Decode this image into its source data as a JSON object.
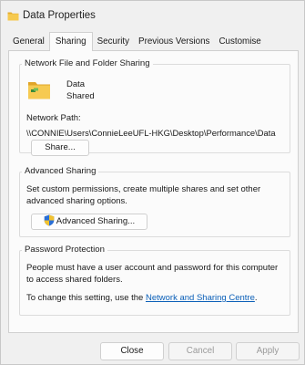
{
  "window": {
    "title": "Data Properties"
  },
  "tabs": [
    {
      "label": "General"
    },
    {
      "label": "Sharing"
    },
    {
      "label": "Security"
    },
    {
      "label": "Previous Versions"
    },
    {
      "label": "Customise"
    }
  ],
  "network_sharing": {
    "legend": "Network File and Folder Sharing",
    "folder_name": "Data",
    "folder_state": "Shared",
    "path_label": "Network Path:",
    "path_value": "\\\\CONNIE\\Users\\ConnieLeeUFL-HKG\\Desktop\\Performance\\Data",
    "share_button": "Share..."
  },
  "advanced_sharing": {
    "legend": "Advanced Sharing",
    "description_line1": "Set custom permissions, create multiple shares and set other",
    "description_line2": "advanced sharing options.",
    "button": "Advanced Sharing..."
  },
  "password_protection": {
    "legend": "Password Protection",
    "line1": "People must have a user account and password for this computer",
    "line2": "to access shared folders.",
    "change_prefix": "To change this setting, use the ",
    "change_link": "Network and Sharing Centre",
    "change_suffix": "."
  },
  "footer": {
    "close": "Close",
    "cancel": "Cancel",
    "apply": "Apply"
  },
  "colors": {
    "link": "#0a5fb8",
    "folder": "#f3c24a",
    "shield_blue": "#2a6fd6",
    "shield_yellow": "#f2c230"
  }
}
